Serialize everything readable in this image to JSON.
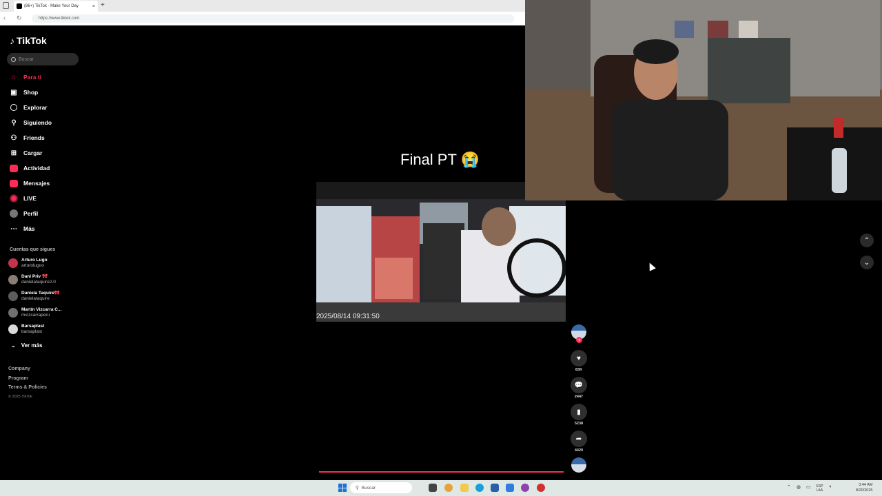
{
  "browser": {
    "tab_title": "(86+) TikTok - Make Your Day",
    "tab_close": "×",
    "new_tab": "+",
    "url": "https://www.tiktok.com"
  },
  "tiktok": {
    "logo_text": "TikTok",
    "search_placeholder": "Buscar",
    "nav": [
      {
        "label": "Para ti",
        "icon": "home-icon",
        "active": true
      },
      {
        "label": "Shop",
        "icon": "shop-icon"
      },
      {
        "label": "Explorar",
        "icon": "compass-icon"
      },
      {
        "label": "Siguiendo",
        "icon": "following-icon"
      },
      {
        "label": "Friends",
        "icon": "friends-icon"
      },
      {
        "label": "Cargar",
        "icon": "upload-icon"
      },
      {
        "label": "Actividad",
        "icon": "activity-icon"
      },
      {
        "label": "Mensajes",
        "icon": "messages-icon"
      },
      {
        "label": "LIVE",
        "icon": "live-icon"
      },
      {
        "label": "Perfil",
        "icon": "profile-icon"
      },
      {
        "label": "Más",
        "icon": "more-icon"
      }
    ],
    "following_title": "Cuentas que sigues",
    "following": [
      {
        "name": "Arturo Lugo",
        "user": "arturolugoo"
      },
      {
        "name": "Dani Priv 🎀",
        "user": "danielataquire2.0"
      },
      {
        "name": "Daniela Taquire🎀",
        "user": "danielataquire"
      },
      {
        "name": "Martín Vizcarra C...",
        "user": "mvizcarraperu"
      },
      {
        "name": "Barsaplast",
        "user": "barsaplast"
      }
    ],
    "ver_mas": "Ver más",
    "footer": [
      "Company",
      "Program",
      "Terms & Policies"
    ],
    "copyright": "© 2025 TikTok"
  },
  "video": {
    "caption": "Final PT 😭",
    "timestamp": "2025/08/14  09:31:50",
    "progress": 0.97,
    "likes": "83K",
    "comments": "2447",
    "saves": "5238",
    "shares": "4420"
  },
  "taskbar": {
    "search": "Buscar",
    "lang": "ESP\nLAA",
    "time": "3:44 AM",
    "date": "8/20/2025"
  },
  "colors": {
    "accent": "#fe2c55"
  }
}
